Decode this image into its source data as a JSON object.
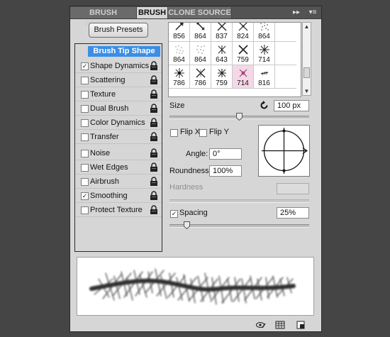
{
  "tabs": [
    {
      "label": "BRUSH PRESETS",
      "active": false
    },
    {
      "label": "BRUSH",
      "active": true
    },
    {
      "label": "CLONE SOURCE",
      "active": false
    }
  ],
  "tab_controls": {
    "collapse": "▸▸",
    "menu": "▾≡"
  },
  "preset_button": "Brush Presets",
  "options": [
    {
      "label": "Brush Tip Shape",
      "checkbox": false,
      "checked": false,
      "selected": true,
      "lock": false
    },
    {
      "label": "Shape Dynamics",
      "checkbox": true,
      "checked": true,
      "lock": true
    },
    {
      "label": "Scattering",
      "checkbox": true,
      "checked": false,
      "lock": true
    },
    {
      "label": "Texture",
      "checkbox": true,
      "checked": false,
      "lock": true
    },
    {
      "label": "Dual Brush",
      "checkbox": true,
      "checked": false,
      "lock": true
    },
    {
      "label": "Color Dynamics",
      "checkbox": true,
      "checked": false,
      "lock": true
    },
    {
      "label": "Transfer",
      "checkbox": true,
      "checked": false,
      "lock": true
    },
    {
      "label": "Noise",
      "checkbox": true,
      "checked": false,
      "lock": true
    },
    {
      "label": "Wet Edges",
      "checkbox": true,
      "checked": false,
      "lock": true
    },
    {
      "label": "Airbrush",
      "checkbox": true,
      "checked": false,
      "lock": true
    },
    {
      "label": "Smoothing",
      "checkbox": true,
      "checked": true,
      "lock": true
    },
    {
      "label": "Protect Texture",
      "checkbox": true,
      "checked": false,
      "lock": true
    }
  ],
  "brush_tips": [
    {
      "size": "856"
    },
    {
      "size": "864"
    },
    {
      "size": "837"
    },
    {
      "size": "824"
    },
    {
      "size": "864"
    },
    {
      "size": "",
      "blank": true
    },
    {
      "size": "864"
    },
    {
      "size": "864"
    },
    {
      "size": "643"
    },
    {
      "size": "759"
    },
    {
      "size": "714"
    },
    {
      "size": "",
      "blank": true
    },
    {
      "size": "786"
    },
    {
      "size": "786"
    },
    {
      "size": "759"
    },
    {
      "size": "714",
      "selected": true
    },
    {
      "size": "816"
    },
    {
      "size": "",
      "blank": true
    }
  ],
  "size": {
    "label": "Size",
    "value": "100 px",
    "slider_fraction": 0.5
  },
  "flip_x": {
    "label": "Flip X",
    "checked": false
  },
  "flip_y": {
    "label": "Flip Y",
    "checked": false
  },
  "angle": {
    "label": "Angle:",
    "value": "0°"
  },
  "roundness": {
    "label": "Roundness:",
    "value": "100%"
  },
  "hardness": {
    "label": "Hardness",
    "value": ""
  },
  "spacing": {
    "label": "Spacing",
    "checked": true,
    "value": "25%",
    "slider_fraction": 0.12
  },
  "colors": {
    "selected_tip": "#f5d7e7",
    "tip_header": "#3a8ee6"
  }
}
